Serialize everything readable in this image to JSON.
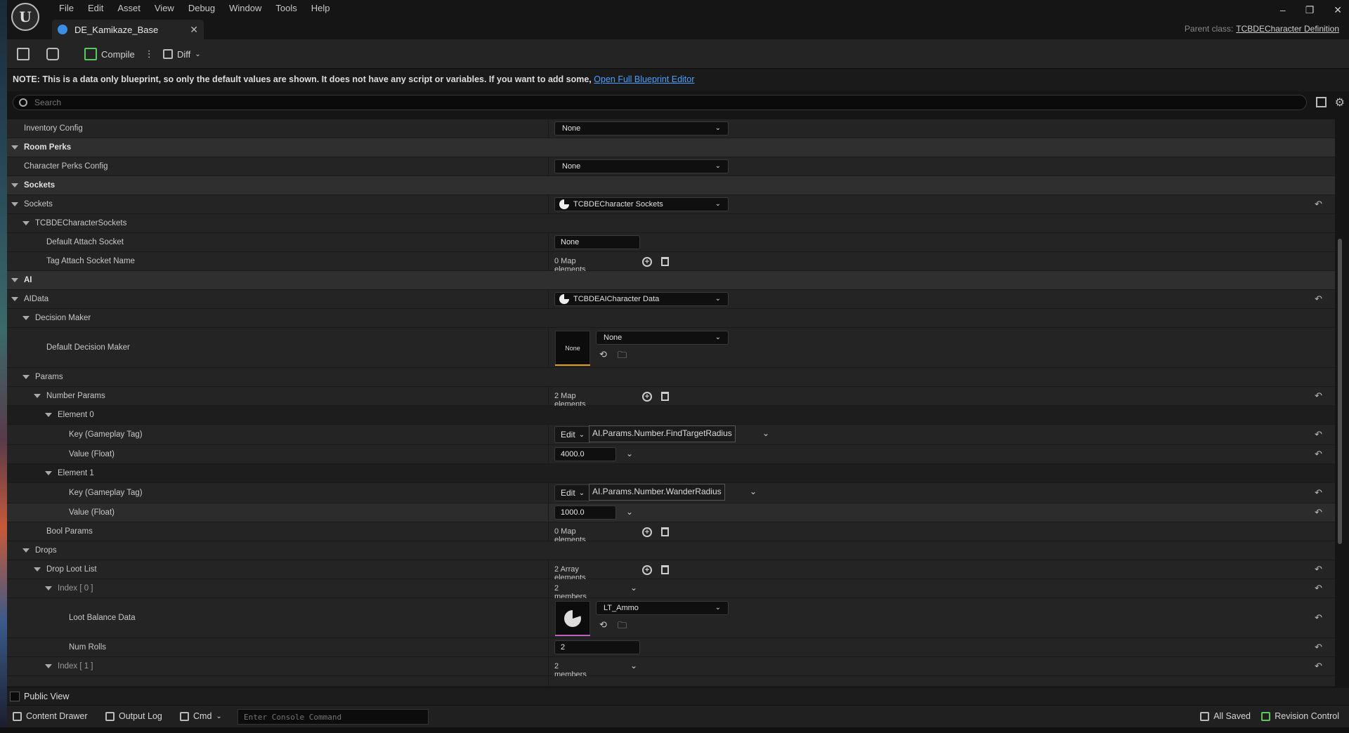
{
  "window": {
    "menu": [
      "File",
      "Edit",
      "Asset",
      "View",
      "Debug",
      "Window",
      "Tools",
      "Help"
    ],
    "tab_title": "DE_Kamikaze_Base",
    "parent_class_label": "Parent class:",
    "parent_class_value": "TCBDECharacter Definition",
    "controls": [
      "–",
      "❐",
      "✕"
    ]
  },
  "toolbar": {
    "compile_label": "Compile",
    "diff_label": "Diff"
  },
  "note": {
    "text": "NOTE: This is a data only blueprint, so only the default values are shown.  It does not have any script or variables.  If you want to add some,",
    "link": "Open Full Blueprint Editor"
  },
  "search": {
    "placeholder": "Search"
  },
  "details": {
    "inventory_config": {
      "label": "Inventory Config",
      "value": "None"
    },
    "room_perks": {
      "label": "Room Perks"
    },
    "character_perks_config": {
      "label": "Character Perks Config",
      "value": "None"
    },
    "sockets_cat": {
      "label": "Sockets"
    },
    "sockets": {
      "label": "Sockets",
      "value": "TCBDECharacter Sockets"
    },
    "tcbde_sockets": {
      "label": "TCBDECharacterSockets"
    },
    "default_attach_socket": {
      "label": "Default Attach Socket",
      "value": "None"
    },
    "tag_attach_socket": {
      "label": "Tag Attach Socket Name",
      "value": "0 Map elements"
    },
    "ai_cat": {
      "label": "AI"
    },
    "aidata": {
      "label": "AIData",
      "value": "TCBDEAICharacter Data"
    },
    "decision_maker": {
      "label": "Decision Maker"
    },
    "default_decision_maker": {
      "label": "Default Decision Maker",
      "thumb": "None",
      "value": "None"
    },
    "params": {
      "label": "Params"
    },
    "number_params": {
      "label": "Number Params",
      "value": "2 Map elements"
    },
    "element0": {
      "label": "Element 0"
    },
    "key0": {
      "label": "Key (Gameplay Tag)",
      "edit": "Edit",
      "value": "AI.Params.Number.FindTargetRadius"
    },
    "val0": {
      "label": "Value (Float)",
      "value": "4000.0"
    },
    "element1": {
      "label": "Element 1"
    },
    "key1": {
      "label": "Key (Gameplay Tag)",
      "edit": "Edit",
      "value": "AI.Params.Number.WanderRadius"
    },
    "val1": {
      "label": "Value (Float)",
      "value": "1000.0"
    },
    "bool_params": {
      "label": "Bool Params",
      "value": "0 Map elements"
    },
    "drops": {
      "label": "Drops"
    },
    "drop_loot_list": {
      "label": "Drop Loot List",
      "value": "2 Array elements"
    },
    "index0": {
      "label": "Index [ 0 ]",
      "value": "2 members"
    },
    "loot_balance": {
      "label": "Loot Balance Data",
      "value": "LT_Ammo"
    },
    "num_rolls": {
      "label": "Num Rolls",
      "value": "2"
    },
    "index1": {
      "label": "Index [ 1 ]",
      "value": "2 members"
    }
  },
  "public_view": {
    "label": "Public View"
  },
  "statusbar": {
    "content_drawer": "Content Drawer",
    "output_log": "Output Log",
    "cmd": "Cmd",
    "console_placeholder": "Enter Console Command",
    "all_saved": "All Saved",
    "revision_control": "Revision Control"
  },
  "colors": {
    "accent_blue": "#4a9eff",
    "decision_bar": "#e8a200",
    "loot_bar": "#c060c0",
    "tab_icon": "#3a8ee6"
  }
}
